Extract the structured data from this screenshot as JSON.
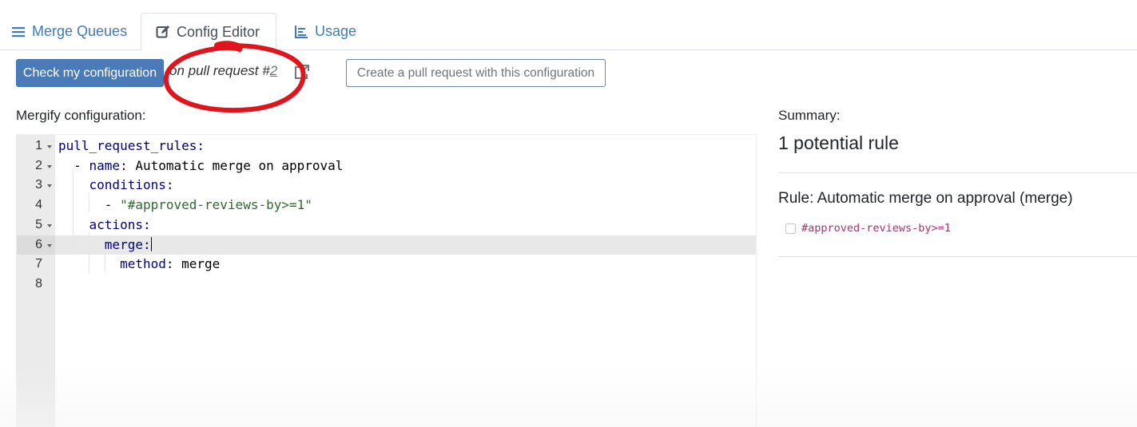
{
  "tabs": [
    {
      "label": "Merge Queues",
      "icon": "list-icon",
      "active": false
    },
    {
      "label": "Config Editor",
      "icon": "edit-icon",
      "active": true
    },
    {
      "label": "Usage",
      "icon": "chart-icon",
      "active": false
    }
  ],
  "toolbar": {
    "check_label": "Check my configuration",
    "pr_prefix": "on pull request #",
    "pr_number": "2",
    "create_pr_label": "Create a pull request with this configuration"
  },
  "editor": {
    "label": "Mergify configuration:",
    "active_line": 6,
    "lines": [
      {
        "num": "1",
        "fold": true,
        "segments": [
          {
            "cls": "k",
            "text": "pull_request_rules:"
          }
        ]
      },
      {
        "num": "2",
        "fold": true,
        "segments": [
          {
            "cls": "",
            "text": "  - "
          },
          {
            "cls": "k",
            "text": "name:"
          },
          {
            "cls": "",
            "text": " Automatic merge on approval"
          }
        ]
      },
      {
        "num": "3",
        "fold": true,
        "segments": [
          {
            "cls": "",
            "text": "    "
          },
          {
            "cls": "k",
            "text": "conditions:"
          }
        ]
      },
      {
        "num": "4",
        "fold": false,
        "segments": [
          {
            "cls": "",
            "text": "      - "
          },
          {
            "cls": "s",
            "text": "\"#approved-reviews-by>=1\""
          }
        ]
      },
      {
        "num": "5",
        "fold": true,
        "segments": [
          {
            "cls": "",
            "text": "    "
          },
          {
            "cls": "k",
            "text": "actions:"
          }
        ]
      },
      {
        "num": "6",
        "fold": true,
        "segments": [
          {
            "cls": "",
            "text": "      "
          },
          {
            "cls": "k",
            "text": "merge:"
          }
        ]
      },
      {
        "num": "7",
        "fold": false,
        "segments": [
          {
            "cls": "",
            "text": "        "
          },
          {
            "cls": "k",
            "text": "method:"
          },
          {
            "cls": "",
            "text": " merge"
          }
        ]
      },
      {
        "num": "8",
        "fold": false,
        "segments": []
      }
    ]
  },
  "summary": {
    "label": "Summary:",
    "title": "1 potential rule",
    "rule_title": "Rule: Automatic merge on approval (merge)",
    "conditions": [
      "#approved-reviews-by>=1"
    ]
  },
  "colors": {
    "accent": "#3f7bbd",
    "primary_button": "#4a7ab8",
    "annotation": "#e0141c",
    "condition_text": "#b0306f"
  }
}
